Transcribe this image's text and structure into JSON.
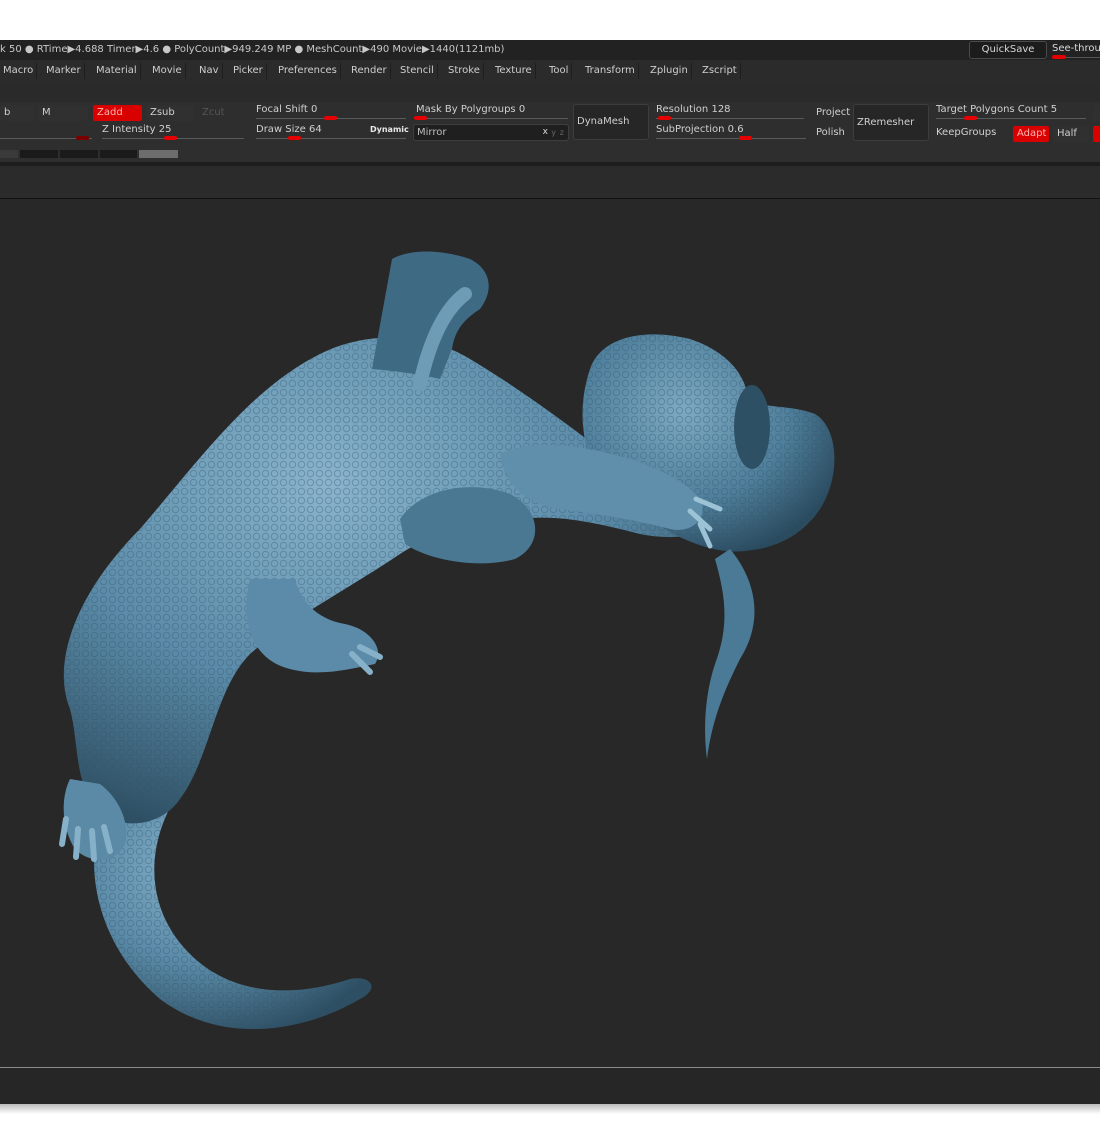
{
  "status": {
    "text": "k 50 ● RTime▶4.688 Timer▶4.6 ● PolyCount▶949.249 MP ● MeshCount▶490 Movie▶1440(1121mb)",
    "quicksave": "QuickSave",
    "seethrough": "See-throu"
  },
  "menu": [
    "Macro",
    "Marker",
    "Material",
    "Movie",
    "Nav",
    "Picker",
    "Preferences",
    "Render",
    "Stencil",
    "Stroke",
    "Texture",
    "Tool",
    "Transform",
    "Zplugin",
    "Zscript"
  ],
  "shelf": {
    "b_label": "b",
    "m_label": "M",
    "zadd": "Zadd",
    "zsub": "Zsub",
    "zcut": "Zcut",
    "z_intensity": {
      "label": "Z Intensity",
      "value": "25"
    },
    "focal_shift": {
      "label": "Focal Shift",
      "value": "0"
    },
    "draw_size": {
      "label": "Draw Size",
      "value": "64"
    },
    "dynamic": "Dynamic",
    "mask_by_polygroups": {
      "label": "Mask By Polygroups",
      "value": "0"
    },
    "mirror": "Mirror",
    "mirror_axes": [
      "x",
      "y",
      "z"
    ],
    "dynamesh": "DynaMesh",
    "resolution": {
      "label": "Resolution",
      "value": "128"
    },
    "subprojection": {
      "label": "SubProjection",
      "value": "0.6"
    },
    "project": "Project",
    "polish": "Polish",
    "zremesher": "ZRemesher",
    "target_polygons": {
      "label": "Target Polygons Count",
      "value": "5"
    },
    "keepgroups": "KeepGroups",
    "adapt": "Adapt",
    "half": "Half"
  },
  "colors": {
    "accent_red": "#e60000",
    "canvas_bg": "#282828",
    "model_color": "#5b8ba8"
  }
}
